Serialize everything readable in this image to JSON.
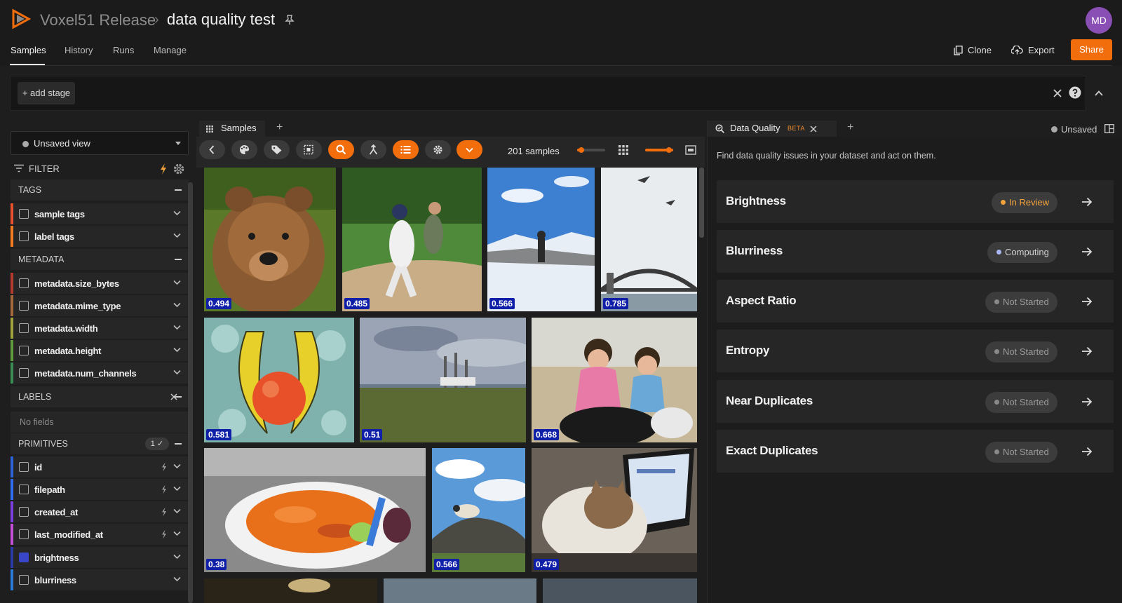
{
  "header": {
    "app_title": "Voxel51 Release",
    "separator": "›",
    "dataset_title": "data quality test",
    "avatar_initials": "MD"
  },
  "nav": {
    "tabs": [
      "Samples",
      "History",
      "Runs",
      "Manage"
    ],
    "active_tab": "Samples",
    "clone_label": "Clone",
    "export_label": "Export",
    "share_label": "Share"
  },
  "stage_bar": {
    "add_stage_label": "+ add stage"
  },
  "sidebar": {
    "view_select_value": "Unsaved view",
    "filter_label": "FILTER",
    "groups": {
      "tags": "TAGS",
      "metadata": "METADATA",
      "labels": "LABELS",
      "primitives": "PRIMITIVES"
    },
    "tag_fields": [
      "sample tags",
      "label tags"
    ],
    "metadata_fields": [
      "metadata.size_bytes",
      "metadata.mime_type",
      "metadata.width",
      "metadata.height",
      "metadata.num_channels"
    ],
    "no_fields_label": "No fields",
    "primitives_badge": "1 ✓",
    "primitive_fields": [
      "id",
      "filepath",
      "created_at",
      "last_modified_at",
      "brightness",
      "blurriness"
    ],
    "checked_field": "brightness",
    "field_colors": {
      "sample tags": "#e8502e",
      "label tags": "#f27b22",
      "metadata.size_bytes": "#b33a2e",
      "metadata.mime_type": "#a3683c",
      "metadata.width": "#9ea33c",
      "metadata.height": "#5f9a3c",
      "metadata.num_channels": "#3c8a54",
      "id": "#2e63d8",
      "filepath": "#2e6ef0",
      "created_at": "#7b3ee0",
      "last_modified_at": "#c24fd6",
      "brightness": "#2c3aa8",
      "blurriness": "#2c7ad8"
    }
  },
  "samples_panel": {
    "tab_label": "Samples",
    "add_tab": "+",
    "sample_count": "201 samples",
    "tiles": [
      {
        "score": "0.494",
        "subject": "bear"
      },
      {
        "score": "0.485",
        "subject": "baseball"
      },
      {
        "score": "0.566",
        "subject": "snow"
      },
      {
        "score": "0.785",
        "subject": "bridge"
      },
      {
        "score": "0.581",
        "subject": "fruit"
      },
      {
        "score": "0.51",
        "subject": "boats"
      },
      {
        "score": "0.668",
        "subject": "kids-goats"
      },
      {
        "score": "0.38",
        "subject": "carrots"
      },
      {
        "score": "0.566",
        "subject": "sheep"
      },
      {
        "score": "0.479",
        "subject": "cat-laptop"
      }
    ]
  },
  "data_quality": {
    "tab_label": "Data Quality",
    "beta_label": "BETA",
    "add_tab": "+",
    "unsaved_label": "Unsaved",
    "description": "Find data quality issues in your dataset and act on them.",
    "checks": [
      {
        "name": "Brightness",
        "status": "In Review",
        "status_color": "#f2a33c",
        "text_color": "#f2a33c"
      },
      {
        "name": "Blurriness",
        "status": "Computing",
        "status_color": "#a9b6f2",
        "text_color": "#d0d0d0"
      },
      {
        "name": "Aspect Ratio",
        "status": "Not Started",
        "status_color": "#8a8a8a",
        "text_color": "#9a9a9a"
      },
      {
        "name": "Entropy",
        "status": "Not Started",
        "status_color": "#8a8a8a",
        "text_color": "#9a9a9a"
      },
      {
        "name": "Near Duplicates",
        "status": "Not Started",
        "status_color": "#8a8a8a",
        "text_color": "#9a9a9a"
      },
      {
        "name": "Exact Duplicates",
        "status": "Not Started",
        "status_color": "#8a8a8a",
        "text_color": "#9a9a9a"
      }
    ]
  },
  "colors": {
    "accent": "#f26d0c",
    "score_badge": "#0f1fa8"
  }
}
